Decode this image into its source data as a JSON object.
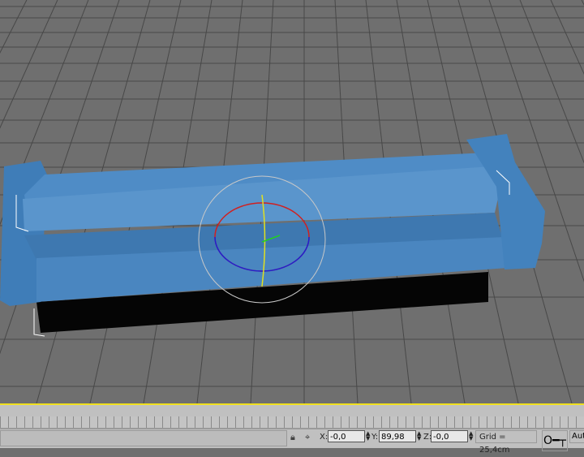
{
  "viewport": {
    "background": "#6f6f6f",
    "grid_color": "#4a4a4a",
    "object_color": "#4a86c0",
    "selection_highlight": "#f0e020"
  },
  "status": {
    "x_label": "X:",
    "x_value": "-0,0",
    "y_label": "Y:",
    "y_value": "89,98",
    "z_label": "Z:",
    "z_value": "-0,0",
    "grid": "Grid = 25,4cm",
    "auto_label": "Auto",
    "lock_icon": "lock-icon",
    "absolute_mode_icon": "absolute-transform-icon",
    "key_icon": "key-icon"
  }
}
